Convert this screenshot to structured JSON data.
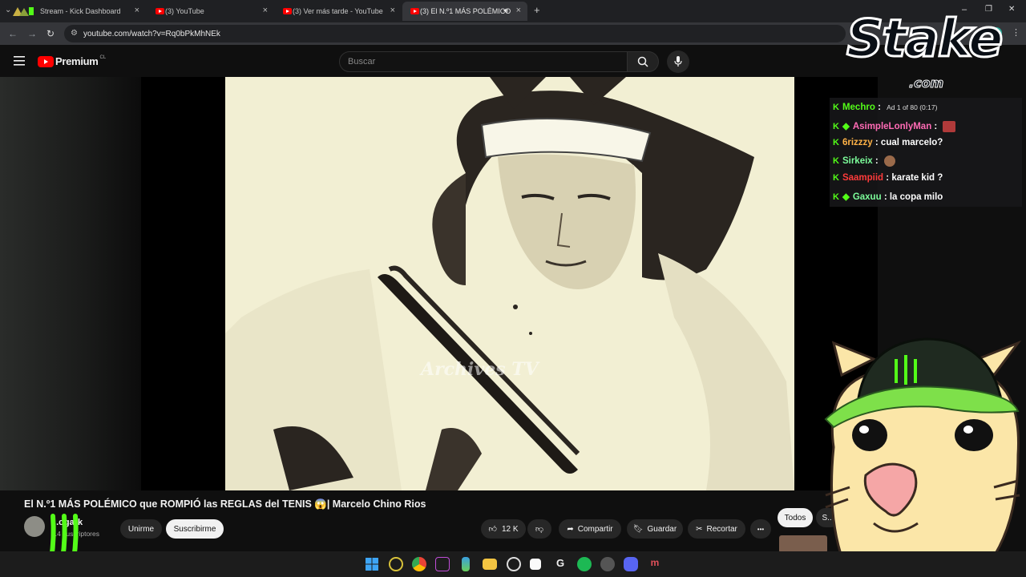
{
  "browser": {
    "tabs": [
      {
        "label": "Stream - Kick Dashboard",
        "active": false
      },
      {
        "label": "(3) YouTube",
        "active": false
      },
      {
        "label": "(3) Ver más tarde - YouTube",
        "active": false
      },
      {
        "label": "(3) El N.º1 MÁS POLÉMICO",
        "active": true
      }
    ],
    "new_tab": "+",
    "close_glyph": "×",
    "url": "youtube.com/watch?v=Rq0bPkMhNEk",
    "window_controls": [
      "–",
      "❐",
      "✕"
    ]
  },
  "youtube": {
    "logo_text": "Premium",
    "country": "CL",
    "search_placeholder": "Buscar",
    "video_watermark": "Archives TV",
    "title": "El N.º1 MÁS POLÉMICO que ROMPIÓ las REGLAS del TENIS 😱| Marcelo Chino Rios",
    "channel_name": "...ogark",
    "subscribers": "...4 suscriptores",
    "join_label": "Unirme",
    "subscribe_label": "Suscribirme",
    "likes": "12 K",
    "share_label": "Compartir",
    "save_label": "Guardar",
    "clip_label": "Recortar",
    "more_glyph": "•••",
    "filter_all": "Todos",
    "filter_next": "S..."
  },
  "overlay": {
    "sponsor_main": "Stake",
    "sponsor_sub": ".com",
    "chat": [
      {
        "user": "Mechro",
        "sep": ":",
        "text": "Ad 1 of 80 (0:17)",
        "color": "#53fc18",
        "extra": ""
      },
      {
        "user": "AsimpleLonlyMan",
        "sep": ":",
        "text": "",
        "color": "#ff6bb5",
        "extra": "emote"
      },
      {
        "user": "6rizzzy",
        "sep": ":",
        "text": "cual marcelo?",
        "color": "#ffb347",
        "extra": ""
      },
      {
        "user": "Sirkeix",
        "sep": ":",
        "text": "",
        "color": "#7cfc9a",
        "extra": "emote"
      },
      {
        "user": "Saampiid",
        "sep": ":",
        "text": "karate kid ?",
        "color": "#ff3b3b",
        "extra": ""
      },
      {
        "user": "Gaxuu",
        "sep": ":",
        "text": "la copa milo",
        "color": "#7cfc9a",
        "extra": ""
      }
    ]
  }
}
